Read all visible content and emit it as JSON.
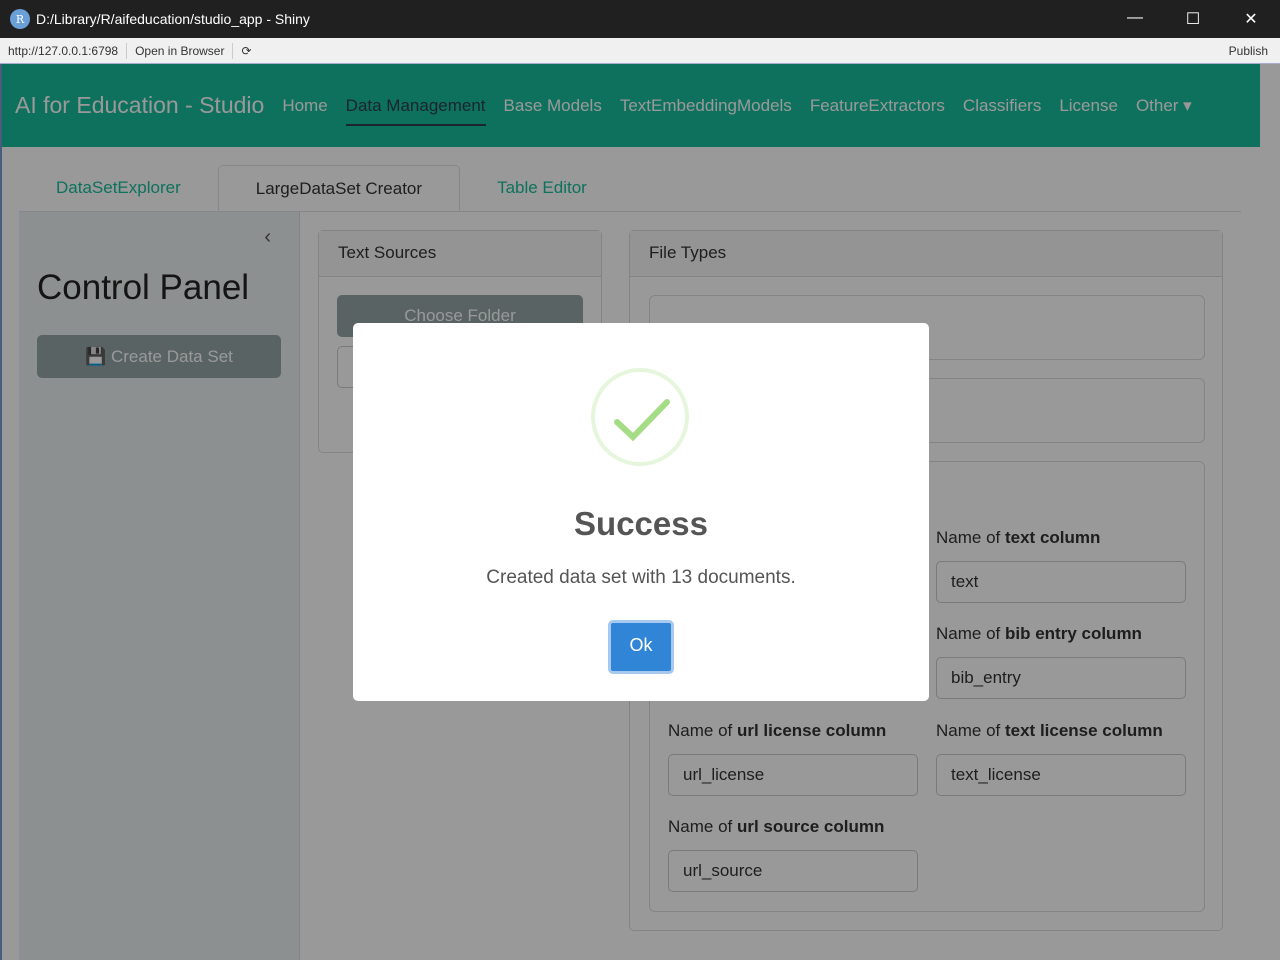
{
  "window": {
    "title": "D:/Library/R/aifeducation/studio_app - Shiny",
    "url": "http://127.0.0.1:6798",
    "open_browser": "Open in Browser",
    "publish": "Publish"
  },
  "nav": {
    "brand": "AI for Education - Studio",
    "items": [
      "Home",
      "Data Management",
      "Base Models",
      "TextEmbeddingModels",
      "FeatureExtractors",
      "Classifiers",
      "License",
      "Other ▾"
    ],
    "active": "Data Management",
    "color": "#18bc9c"
  },
  "tabs": [
    "DataSetExplorer",
    "LargeDataSet Creator",
    "Table Editor"
  ],
  "sidebar": {
    "title": "Control Panel",
    "create_button": "Create Data Set"
  },
  "text_sources": {
    "header": "Text Sources",
    "choose_folder": "Choose Folder"
  },
  "file_types": {
    "header": "File Types",
    "fields": [
      {
        "label_pre": "Name of ",
        "label_bold": "text column",
        "value": "text"
      },
      {
        "label_pre": "Name of ",
        "label_bold": "bib entry column",
        "value": "bib_entry"
      },
      {
        "label_pre": "Name of ",
        "label_bold": "url license column",
        "value": "url_license"
      },
      {
        "label_pre": "Name of ",
        "label_bold": "text license column",
        "value": "text_license"
      },
      {
        "label_pre": "Name of ",
        "label_bold": "url source column",
        "value": "url_source"
      }
    ]
  },
  "modal": {
    "title": "Success",
    "message": "Created data set with 13 documents.",
    "ok": "Ok"
  }
}
